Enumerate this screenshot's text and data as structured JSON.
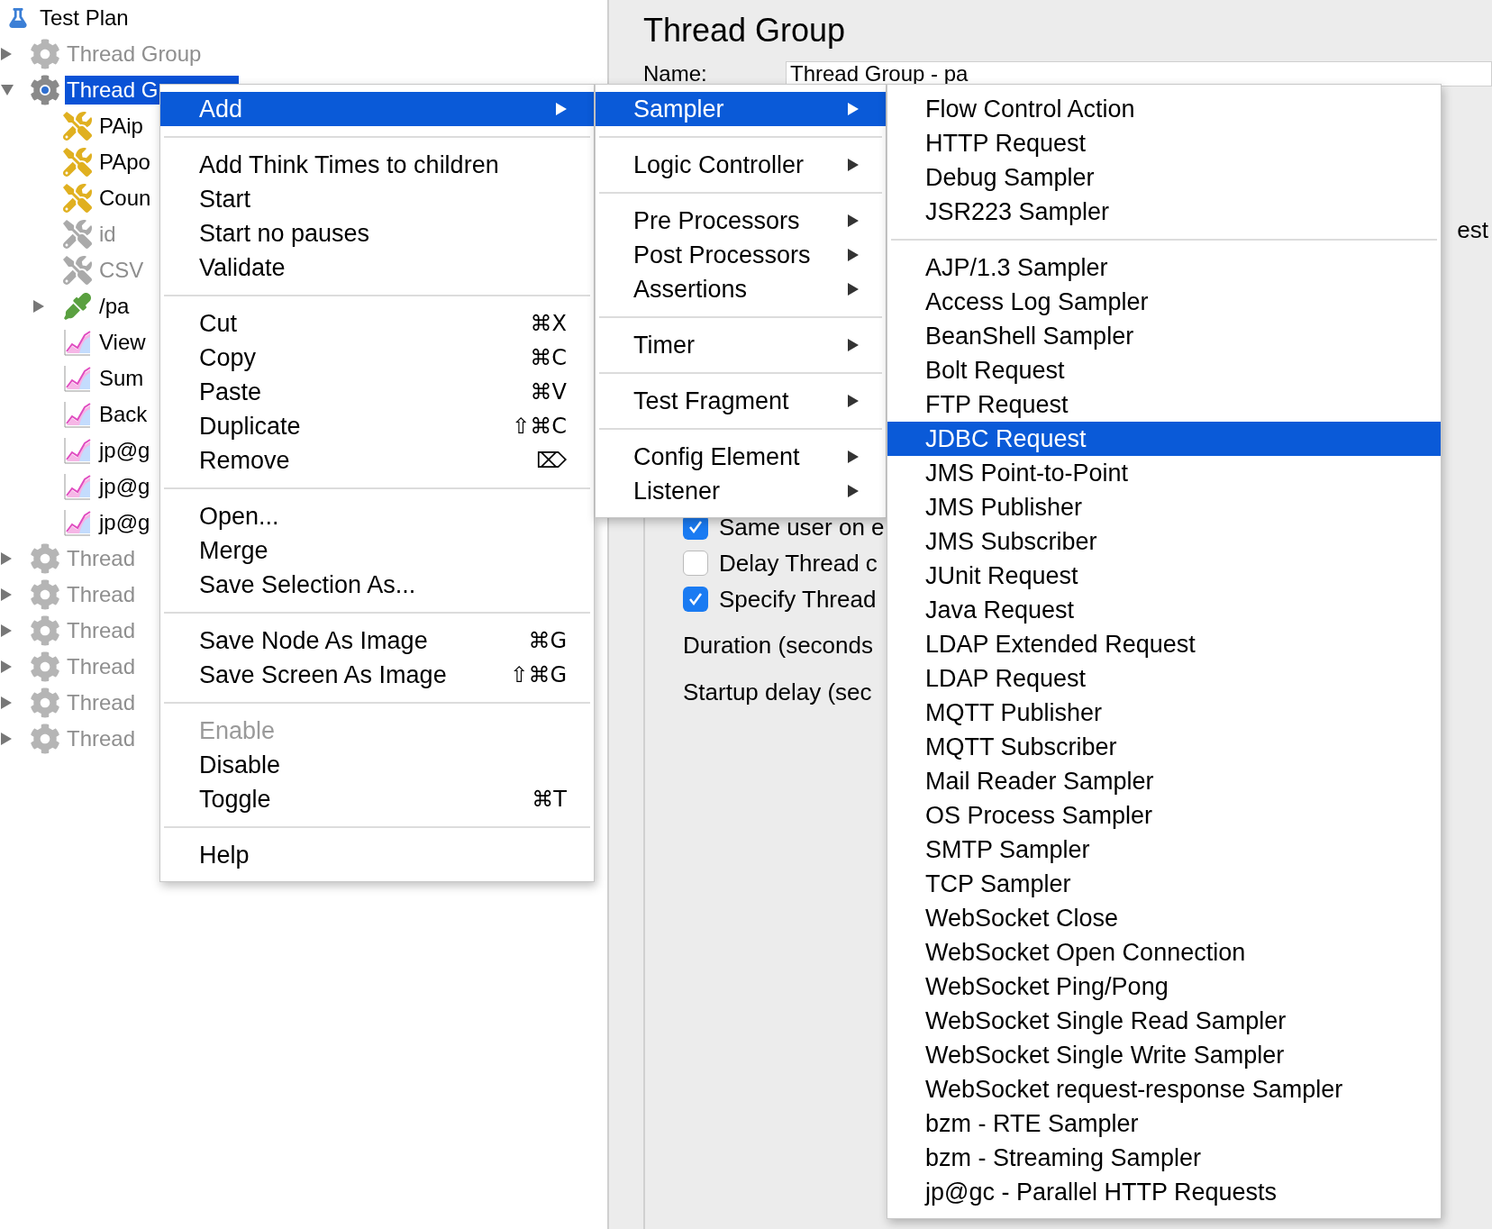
{
  "tree": {
    "items": [
      {
        "label": "Test Plan",
        "kind": "plan",
        "disabled": false,
        "selected": false,
        "children": [
          {
            "label": "Thread Group",
            "kind": "thread_group",
            "disabled": true,
            "selected": false,
            "expanded": false
          },
          {
            "label": "Thread G",
            "kind": "thread_group",
            "disabled": false,
            "selected": true,
            "expanded": true,
            "children": [
              {
                "label": "PAip",
                "kind": "config",
                "disabled": false,
                "selected": false
              },
              {
                "label": "PApo",
                "kind": "config",
                "disabled": false,
                "selected": false
              },
              {
                "label": "Coun",
                "kind": "config",
                "disabled": false,
                "selected": false
              },
              {
                "label": "id",
                "kind": "config",
                "disabled": true,
                "selected": false
              },
              {
                "label": "CSV",
                "kind": "config",
                "disabled": true,
                "selected": false
              },
              {
                "label": "/pa",
                "kind": "sampler",
                "disabled": false,
                "selected": false,
                "expanded": false
              },
              {
                "label": "View",
                "kind": "listener",
                "disabled": false,
                "selected": false
              },
              {
                "label": "Sum",
                "kind": "listener",
                "disabled": false,
                "selected": false
              },
              {
                "label": "Back",
                "kind": "listener",
                "disabled": false,
                "selected": false
              },
              {
                "label": "jp@g",
                "kind": "listener",
                "disabled": false,
                "selected": false
              },
              {
                "label": "jp@g",
                "kind": "listener",
                "disabled": false,
                "selected": false
              },
              {
                "label": "jp@g",
                "kind": "listener",
                "disabled": false,
                "selected": false
              }
            ]
          },
          {
            "label": "Thread",
            "kind": "thread_group",
            "disabled": true,
            "selected": false,
            "expanded": false
          },
          {
            "label": "Thread",
            "kind": "thread_group",
            "disabled": true,
            "selected": false,
            "expanded": false
          },
          {
            "label": "Thread",
            "kind": "thread_group",
            "disabled": true,
            "selected": false,
            "expanded": false
          },
          {
            "label": "Thread",
            "kind": "thread_group",
            "disabled": true,
            "selected": false,
            "expanded": false
          },
          {
            "label": "Thread",
            "kind": "thread_group",
            "disabled": true,
            "selected": false,
            "expanded": false
          },
          {
            "label": "Thread",
            "kind": "thread_group",
            "disabled": true,
            "selected": false,
            "expanded": false
          }
        ]
      }
    ]
  },
  "panel": {
    "title": "Thread Group",
    "name_label": "Name:",
    "name_value": "Thread Group - pa",
    "partial_label": "est",
    "checkboxes": [
      {
        "label": "Same user on e",
        "checked": true
      },
      {
        "label": "Delay Thread c",
        "checked": false
      },
      {
        "label": "Specify Thread",
        "checked": true
      }
    ],
    "field_labels": [
      "Duration (seconds",
      "Startup delay (sec"
    ]
  },
  "context_menu": {
    "groups": [
      [
        {
          "label": "Add",
          "kind": "submenu",
          "selected": true,
          "disabled": false
        }
      ],
      [
        {
          "label": "Add Think Times to children",
          "kind": "command",
          "selected": false,
          "disabled": false
        },
        {
          "label": "Start",
          "kind": "command",
          "selected": false,
          "disabled": false
        },
        {
          "label": "Start no pauses",
          "kind": "command",
          "selected": false,
          "disabled": false
        },
        {
          "label": "Validate",
          "kind": "command",
          "selected": false,
          "disabled": false
        }
      ],
      [
        {
          "label": "Cut",
          "shortcut": "⌘X",
          "kind": "command",
          "selected": false,
          "disabled": false
        },
        {
          "label": "Copy",
          "shortcut": "⌘C",
          "kind": "command",
          "selected": false,
          "disabled": false
        },
        {
          "label": "Paste",
          "shortcut": "⌘V",
          "kind": "command",
          "selected": false,
          "disabled": false
        },
        {
          "label": "Duplicate",
          "shortcut": "⇧⌘C",
          "kind": "command",
          "selected": false,
          "disabled": false
        },
        {
          "label": "Remove",
          "shortcut": "⌦",
          "kind": "command",
          "selected": false,
          "disabled": false
        }
      ],
      [
        {
          "label": "Open...",
          "kind": "command",
          "selected": false,
          "disabled": false
        },
        {
          "label": "Merge",
          "kind": "command",
          "selected": false,
          "disabled": false
        },
        {
          "label": "Save Selection As...",
          "kind": "command",
          "selected": false,
          "disabled": false
        }
      ],
      [
        {
          "label": "Save Node As Image",
          "shortcut": "⌘G",
          "kind": "command",
          "selected": false,
          "disabled": false
        },
        {
          "label": "Save Screen As Image",
          "shortcut": "⇧⌘G",
          "kind": "command",
          "selected": false,
          "disabled": false
        }
      ],
      [
        {
          "label": "Enable",
          "kind": "command",
          "selected": false,
          "disabled": true
        },
        {
          "label": "Disable",
          "kind": "command",
          "selected": false,
          "disabled": false
        },
        {
          "label": "Toggle",
          "shortcut": "⌘T",
          "kind": "command",
          "selected": false,
          "disabled": false
        }
      ],
      [
        {
          "label": "Help",
          "kind": "command",
          "selected": false,
          "disabled": false
        }
      ]
    ]
  },
  "add_submenu": {
    "groups": [
      [
        {
          "label": "Sampler",
          "kind": "submenu",
          "selected": true
        }
      ],
      [
        {
          "label": "Logic Controller",
          "kind": "submenu",
          "selected": false
        }
      ],
      [
        {
          "label": "Pre Processors",
          "kind": "submenu",
          "selected": false
        },
        {
          "label": "Post Processors",
          "kind": "submenu",
          "selected": false
        },
        {
          "label": "Assertions",
          "kind": "submenu",
          "selected": false
        }
      ],
      [
        {
          "label": "Timer",
          "kind": "submenu",
          "selected": false
        }
      ],
      [
        {
          "label": "Test Fragment",
          "kind": "submenu",
          "selected": false
        }
      ],
      [
        {
          "label": "Config Element",
          "kind": "submenu",
          "selected": false
        },
        {
          "label": "Listener",
          "kind": "submenu",
          "selected": false
        }
      ]
    ]
  },
  "sampler_submenu": {
    "groups": [
      [
        {
          "label": "Flow Control Action",
          "selected": false
        },
        {
          "label": "HTTP Request",
          "selected": false
        },
        {
          "label": "Debug Sampler",
          "selected": false
        },
        {
          "label": "JSR223 Sampler",
          "selected": false
        }
      ],
      [
        {
          "label": "AJP/1.3 Sampler",
          "selected": false
        },
        {
          "label": "Access Log Sampler",
          "selected": false
        },
        {
          "label": "BeanShell Sampler",
          "selected": false
        },
        {
          "label": "Bolt Request",
          "selected": false
        },
        {
          "label": "FTP Request",
          "selected": false
        },
        {
          "label": "JDBC Request",
          "selected": true
        },
        {
          "label": "JMS Point-to-Point",
          "selected": false
        },
        {
          "label": "JMS Publisher",
          "selected": false
        },
        {
          "label": "JMS Subscriber",
          "selected": false
        },
        {
          "label": "JUnit Request",
          "selected": false
        },
        {
          "label": "Java Request",
          "selected": false
        },
        {
          "label": "LDAP Extended Request",
          "selected": false
        },
        {
          "label": "LDAP Request",
          "selected": false
        },
        {
          "label": "MQTT Publisher",
          "selected": false
        },
        {
          "label": "MQTT Subscriber",
          "selected": false
        },
        {
          "label": "Mail Reader Sampler",
          "selected": false
        },
        {
          "label": "OS Process Sampler",
          "selected": false
        },
        {
          "label": "SMTP Sampler",
          "selected": false
        },
        {
          "label": "TCP Sampler",
          "selected": false
        },
        {
          "label": "WebSocket Close",
          "selected": false
        },
        {
          "label": "WebSocket Open Connection",
          "selected": false
        },
        {
          "label": "WebSocket Ping/Pong",
          "selected": false
        },
        {
          "label": "WebSocket Single Read Sampler",
          "selected": false
        },
        {
          "label": "WebSocket Single Write Sampler",
          "selected": false
        },
        {
          "label": "WebSocket request-response Sampler",
          "selected": false
        },
        {
          "label": "bzm - RTE Sampler",
          "selected": false
        },
        {
          "label": "bzm - Streaming Sampler",
          "selected": false
        },
        {
          "label": "jp@gc - Parallel HTTP Requests",
          "selected": false
        }
      ]
    ]
  }
}
